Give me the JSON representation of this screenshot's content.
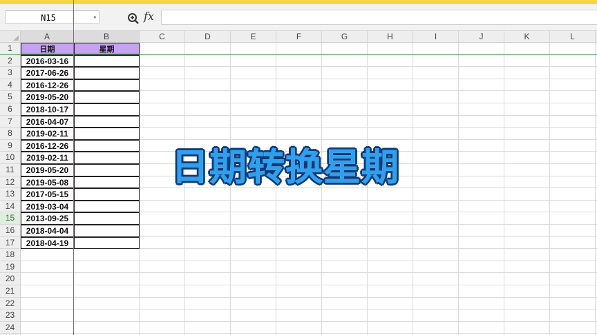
{
  "app": {
    "accent_color": "#f5d84a"
  },
  "formula_bar": {
    "name_box": "N15",
    "name_box_arrow": "▾",
    "zoom_icon": "magnifier-icon",
    "fx_label": "fx",
    "formula": ""
  },
  "columns": [
    "A",
    "B",
    "C",
    "D",
    "E",
    "F",
    "G",
    "H",
    "I",
    "J",
    "K",
    "L"
  ],
  "selected_columns": [
    "A",
    "B"
  ],
  "rows": [
    "1",
    "2",
    "3",
    "4",
    "5",
    "6",
    "7",
    "8",
    "9",
    "10",
    "11",
    "12",
    "13",
    "14",
    "15",
    "16",
    "17",
    "18",
    "19",
    "20",
    "21",
    "22",
    "23",
    "24"
  ],
  "active_row": "15",
  "table": {
    "header_a": "日期",
    "header_b": "星期",
    "header_color": "#c5a3f0",
    "dates": [
      "2016-03-16",
      "2017-06-26",
      "2016-12-26",
      "2019-05-20",
      "2018-10-17",
      "2016-04-07",
      "2019-02-11",
      "2016-12-26",
      "2019-02-11",
      "2019-05-20",
      "2019-05-08",
      "2017-05-15",
      "2019-03-04",
      "2013-09-25",
      "2018-04-04",
      "2018-04-19"
    ]
  },
  "overlay": {
    "title": "日期转换星期",
    "color": "#2ea0ee"
  }
}
